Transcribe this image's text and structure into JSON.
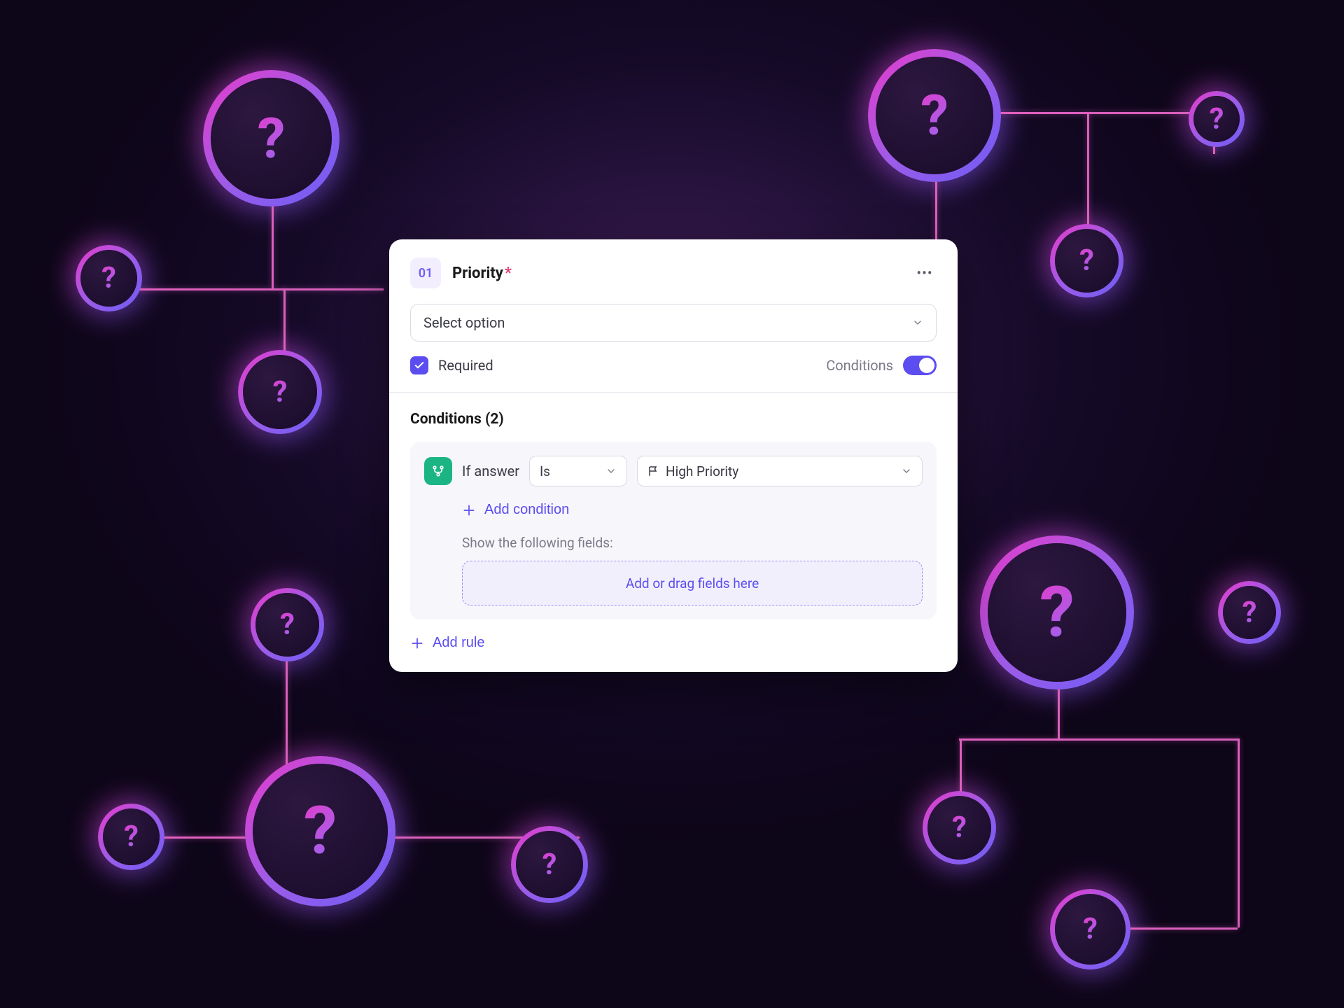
{
  "field": {
    "number": "01",
    "title": "Priority",
    "selectPlaceholder": "Select option",
    "requiredLabel": "Required",
    "conditionsLabel": "Conditions"
  },
  "conditions": {
    "heading": "Conditions (2)",
    "ifAnswer": "If answer",
    "operator": "Is",
    "value": "High Priority",
    "addCondition": "Add condition",
    "showFieldsLabel": "Show the following fields:",
    "dropzone": "Add or drag fields here",
    "addRule": "Add rule"
  }
}
